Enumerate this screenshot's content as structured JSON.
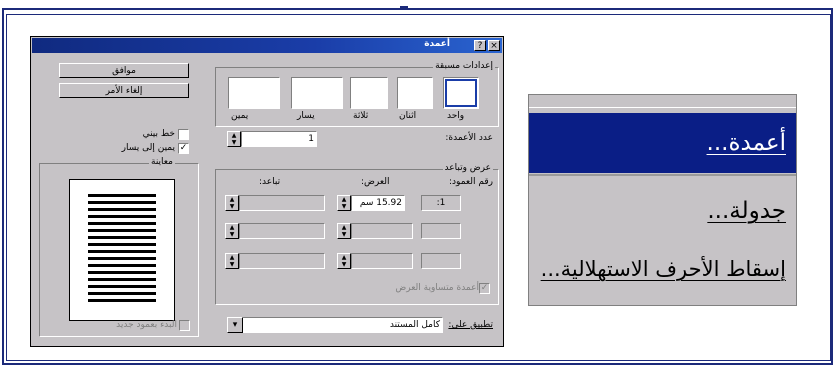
{
  "dialog": {
    "title": "أعمدة",
    "buttons": {
      "ok": "موافق",
      "cancel": "إلغاء الأمر"
    },
    "presets_label": "إعدادات مسبقة",
    "presets": [
      "واحد",
      "اثنان",
      "ثلاثة",
      "يسار",
      "يمين"
    ],
    "num_columns_label": "عدد الأعمدة:",
    "num_columns_value": "1",
    "line_between_label": "خط بيني",
    "right_to_left_label": "يمين إلى يسار",
    "preview_label": "معاينة",
    "width_spacing_label": "عرض وتباعد",
    "col_header": "رقم العمود:",
    "width_header": "العرض:",
    "spacing_header": "تباعد:",
    "row1_col": "1:",
    "row1_width": "15.92 سم",
    "equal_width_label": "أعمدة متساوية العرض",
    "apply_to_label": "تطبيق على:",
    "apply_to_value": "كامل المستند",
    "new_column_label": "البدء بعمود جديد"
  },
  "menu": {
    "items": [
      "أعمدة...",
      "جدولة...",
      "إسقاط الأحرف الاستهلالية..."
    ]
  },
  "colors": {
    "titlebar": "#1a3da8",
    "menu_highlight": "#0a1e86",
    "frame": "#1c2a7a"
  }
}
